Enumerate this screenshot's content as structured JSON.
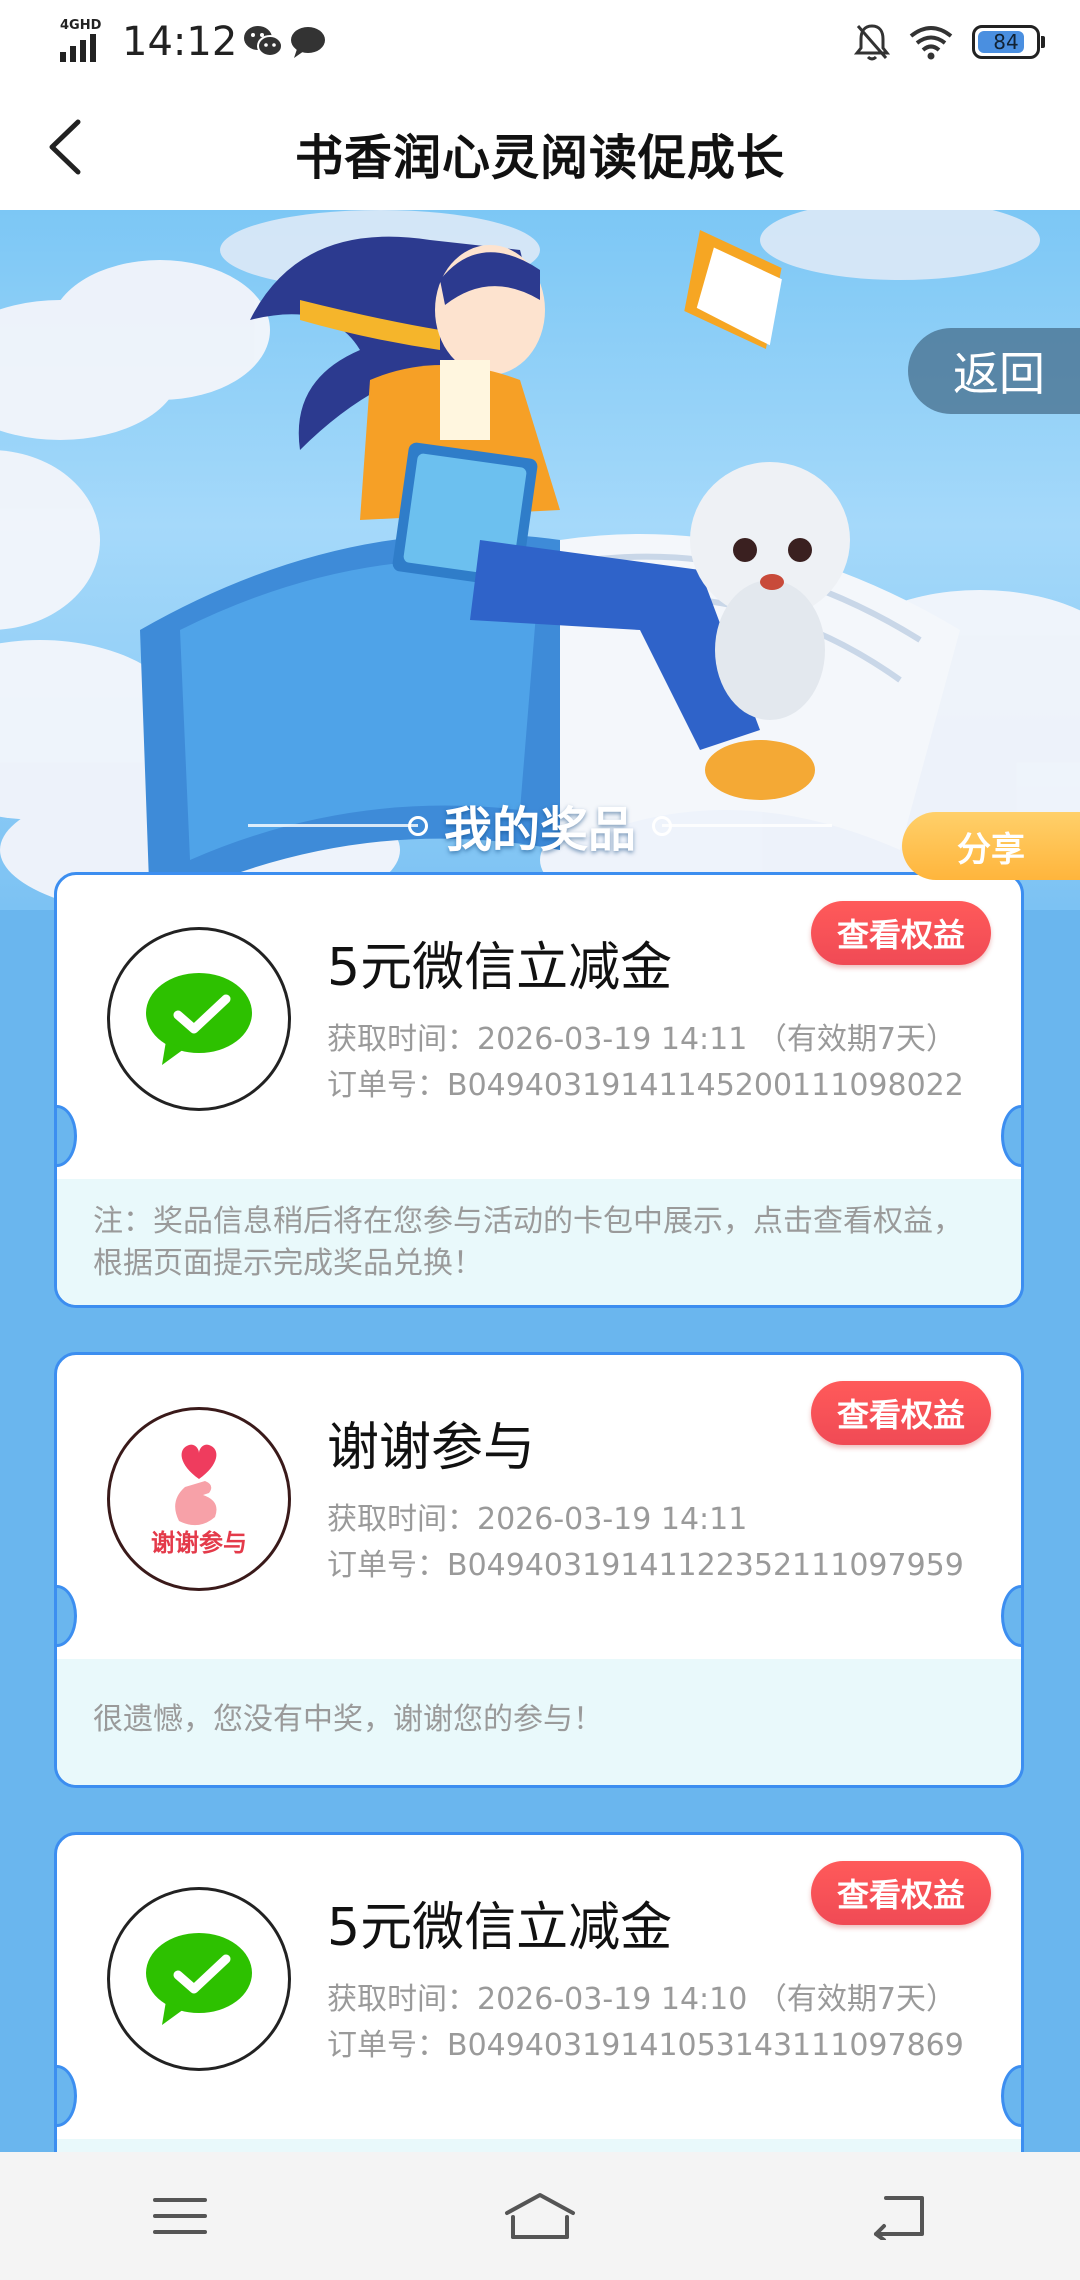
{
  "status_bar": {
    "network": "4GHD",
    "time": "14:12",
    "battery": "84"
  },
  "header": {
    "title": "书香润心灵阅读促成长"
  },
  "banner": {
    "return_label": "返回",
    "section_title": "我的奖品",
    "share_label": "分享"
  },
  "prizes": [
    {
      "name": "5元微信立减金",
      "icon": "wechat-pay-icon",
      "time_label": "获取时间：",
      "time_value": "2026-03-19 14:11 （有效期7天）",
      "order_label": "订单号：",
      "order_value": "B04940319141145200111098022",
      "button": "查看权益",
      "note": "注：奖品信息稍后将在您参与活动的卡包中展示，点击查看权益，根据页面提示完成奖品兑换！"
    },
    {
      "name": "谢谢参与",
      "icon": "thanks-heart-icon",
      "icon_text": "谢谢参与",
      "time_label": "获取时间：",
      "time_value": "2026-03-19 14:11",
      "order_label": "订单号：",
      "order_value": "B04940319141122352111097959",
      "button": "查看权益",
      "note": "很遗憾，您没有中奖，谢谢您的参与！"
    },
    {
      "name": "5元微信立减金",
      "icon": "wechat-pay-icon",
      "time_label": "获取时间：",
      "time_value": "2026-03-19 14:10 （有效期7天）",
      "order_label": "订单号：",
      "order_value": "B04940319141053143111097869",
      "button": "查看权益"
    }
  ],
  "colors": {
    "accent_blue": "#3c8ef0",
    "background": "#6ab6ee",
    "button_red": "#f04a55",
    "share_orange": "#ffb53c",
    "wechat_green": "#2dc100"
  }
}
